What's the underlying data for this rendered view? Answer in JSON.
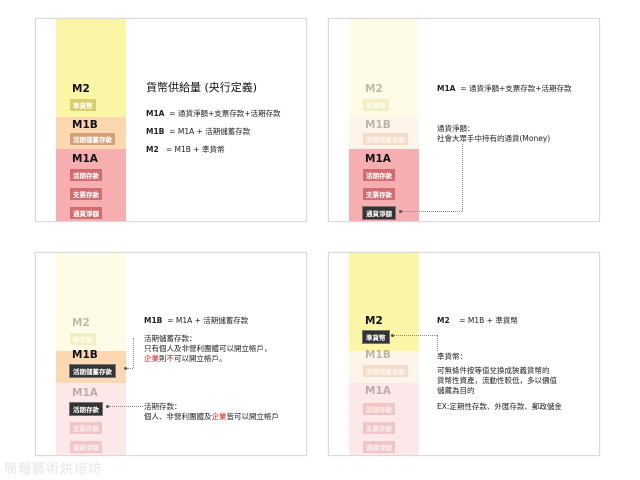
{
  "colors": {
    "m2": "#fbf6a6",
    "m1b": "#fdd8b0",
    "m1a": "#f7aeb0",
    "highlight_text": "#d62020"
  },
  "labels": {
    "m2": "M2",
    "m1b": "M1B",
    "m1a": "M1A",
    "quasi_money": "準貨幣",
    "passbook_savings": "活期儲蓄存款",
    "demand_deposit": "活期存款",
    "check_deposit": "支票存款",
    "currency": "通貨淨額"
  },
  "slide1": {
    "title": "貨幣供給量 (央行定義)",
    "defs": [
      {
        "key": "M1A",
        "val": "= 通貨淨額+支票存款+活期存款"
      },
      {
        "key": "M1B",
        "val": "= M1A + 活期儲蓄存款"
      },
      {
        "key": "M2",
        "val": "= M1B + 準貨幣"
      }
    ]
  },
  "slide2": {
    "def_key": "M1A",
    "def_val": "= 通貨淨額+支票存款+活期存款",
    "note_title": "通貨淨額：",
    "note_body": "社會大眾手中持有的通貨(Money)"
  },
  "slide3": {
    "def_key": "M1B",
    "def_val": "= M1A + 活期儲蓄存款",
    "note1_title": "活期儲蓄存款：",
    "note1_line1": "只有個人及非營利團體可以開立帳戶，",
    "note1_line2_red1": "企業",
    "note1_line2_mid": "則",
    "note1_line2_red2": "不",
    "note1_line2_end": "可以開立帳戶。",
    "note2_title": "活期存款：",
    "note2_pre": "個人、非營利團體及",
    "note2_red": "企業",
    "note2_post": "皆可以開立帳戶"
  },
  "slide4": {
    "def_key": "M2",
    "def_val": "= M1B + 準貨幣",
    "note_title": "準貨幣：",
    "note_line1": "可無條件按等值兌換成狹義貨幣的",
    "note_line2": "貨幣性資產，流動性較低，多以價值",
    "note_line3": "儲藏為目的",
    "note_line4": "EX:定期性存款、外匯存款、郵政儲金"
  },
  "watermark": "簡報藝術烘焙坊"
}
